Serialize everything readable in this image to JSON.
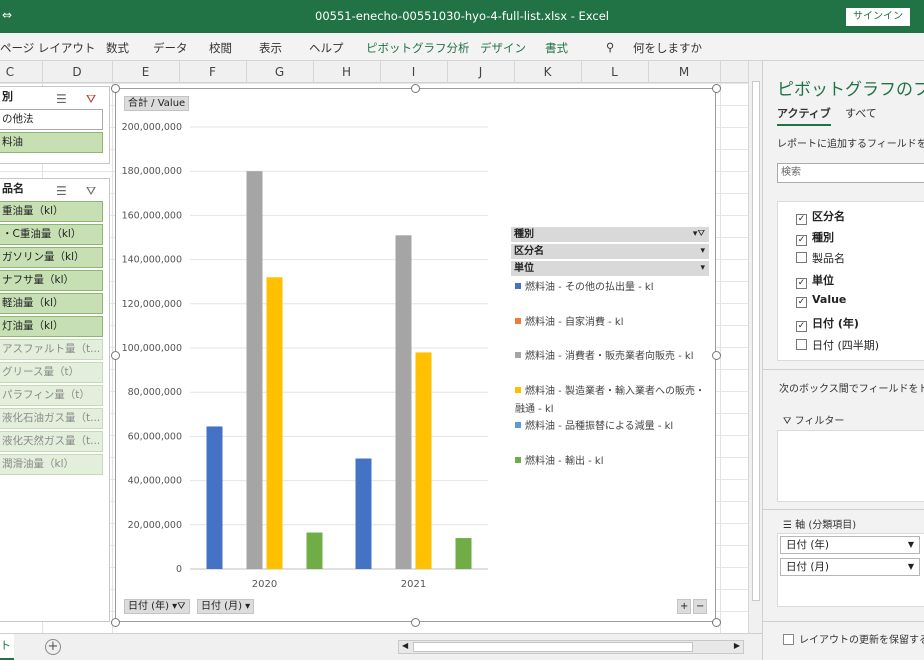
{
  "titlebar": {
    "quick_access": "⇔",
    "title": "00551-enecho-00551030-hyo-4-full-list.xlsx  -  Excel",
    "signin": "サインイン"
  },
  "ribbon": {
    "tabs": [
      "ページ レイアウト",
      "数式",
      "データ",
      "校閲",
      "表示",
      "ヘルプ"
    ],
    "context_tabs": [
      "ピボットグラフ分析",
      "デザイン",
      "書式"
    ],
    "tellme": "何をしますか"
  },
  "columns": [
    "C",
    "D",
    "E",
    "F",
    "G",
    "H",
    "I",
    "J",
    "K",
    "L",
    "M"
  ],
  "slicer1": {
    "header": "別",
    "items": [
      {
        "label": "の他法",
        "state": "wht"
      },
      {
        "label": "料油",
        "state": "sel"
      }
    ]
  },
  "slicer2": {
    "header": "品名",
    "items": [
      {
        "label": "重油量（kl）",
        "state": "sel"
      },
      {
        "label": "・C重油量（kl）",
        "state": "sel"
      },
      {
        "label": "ガソリン量（kl）",
        "state": "sel"
      },
      {
        "label": "ナフサ量（kl）",
        "state": "sel"
      },
      {
        "label": "軽油量（kl）",
        "state": "sel"
      },
      {
        "label": "灯油量（kl）",
        "state": "sel"
      },
      {
        "label": "アスファルト量（t...",
        "state": "dim"
      },
      {
        "label": "グリース量（t）",
        "state": "dim"
      },
      {
        "label": "パラフィン量（t）",
        "state": "dim"
      },
      {
        "label": "液化石油ガス量（t...",
        "state": "dim"
      },
      {
        "label": "液化天然ガス量（t...",
        "state": "dim"
      },
      {
        "label": "潤滑油量（kl）",
        "state": "dim"
      }
    ]
  },
  "chart_data": {
    "type": "bar",
    "value_field_button": "合計 / Value",
    "categories": [
      "2020",
      "2021"
    ],
    "ylim": [
      0,
      200000000
    ],
    "yticks": [
      "200,000,000",
      "180,000,000",
      "160,000,000",
      "140,000,000",
      "120,000,000",
      "100,000,000",
      "80,000,000",
      "60,000,000",
      "40,000,000",
      "20,000,000",
      "0"
    ],
    "series": [
      {
        "name": "燃料油 - その他の払出量 - kl",
        "color": "#4472c4",
        "values": [
          64500000,
          50000000
        ]
      },
      {
        "name": "燃料油 - 自家消費 - kl",
        "color": "#ed7d31",
        "values": [
          0,
          0
        ]
      },
      {
        "name": "燃料油 - 消費者・販売業者向販売 - kl",
        "color": "#a5a5a5",
        "values": [
          180000000,
          151000000
        ]
      },
      {
        "name": "燃料油 - 製造業者・輸入業者への販売・融通 - kl",
        "color": "#ffc000",
        "values": [
          132000000,
          98000000
        ]
      },
      {
        "name": "燃料油 - 品種振替による減量 - kl",
        "color": "#5b9bd5",
        "values": [
          0,
          0
        ]
      },
      {
        "name": "燃料油 - 輸出 - kl",
        "color": "#70ad47",
        "values": [
          16500000,
          14000000
        ]
      }
    ],
    "legend_filters": [
      "種別",
      "区分名",
      "単位"
    ],
    "axis_filters": [
      "日付 (年)",
      "日付 (月)"
    ],
    "zoom": [
      "+",
      "−"
    ],
    "grid": true,
    "legend_position": "right"
  },
  "panel": {
    "title": "ピボットグラフのフィールド",
    "tabs": [
      "アクティブ",
      "すべて"
    ],
    "hint": "レポートに追加するフィールドを選択してください:",
    "search_placeholder": "検索",
    "fields": [
      {
        "label": "区分名",
        "checked": true
      },
      {
        "label": "種別",
        "checked": true
      },
      {
        "label": "製品名",
        "checked": false
      },
      {
        "label": "単位",
        "checked": true
      },
      {
        "label": "Value",
        "checked": true
      },
      {
        "label": "日付 (年)",
        "checked": true
      },
      {
        "label": "日付 (四半期)",
        "checked": false
      }
    ],
    "drag_hint": "次のボックス間でフィールドをドラッグしてください:",
    "filter_label": "フィルター",
    "axis_label": "軸 (分類項目)",
    "axis_items": [
      "日付 (年)",
      "日付 (月)"
    ],
    "defer_label": "レイアウトの更新を保留する"
  },
  "sheet": {
    "tab": "ト"
  }
}
